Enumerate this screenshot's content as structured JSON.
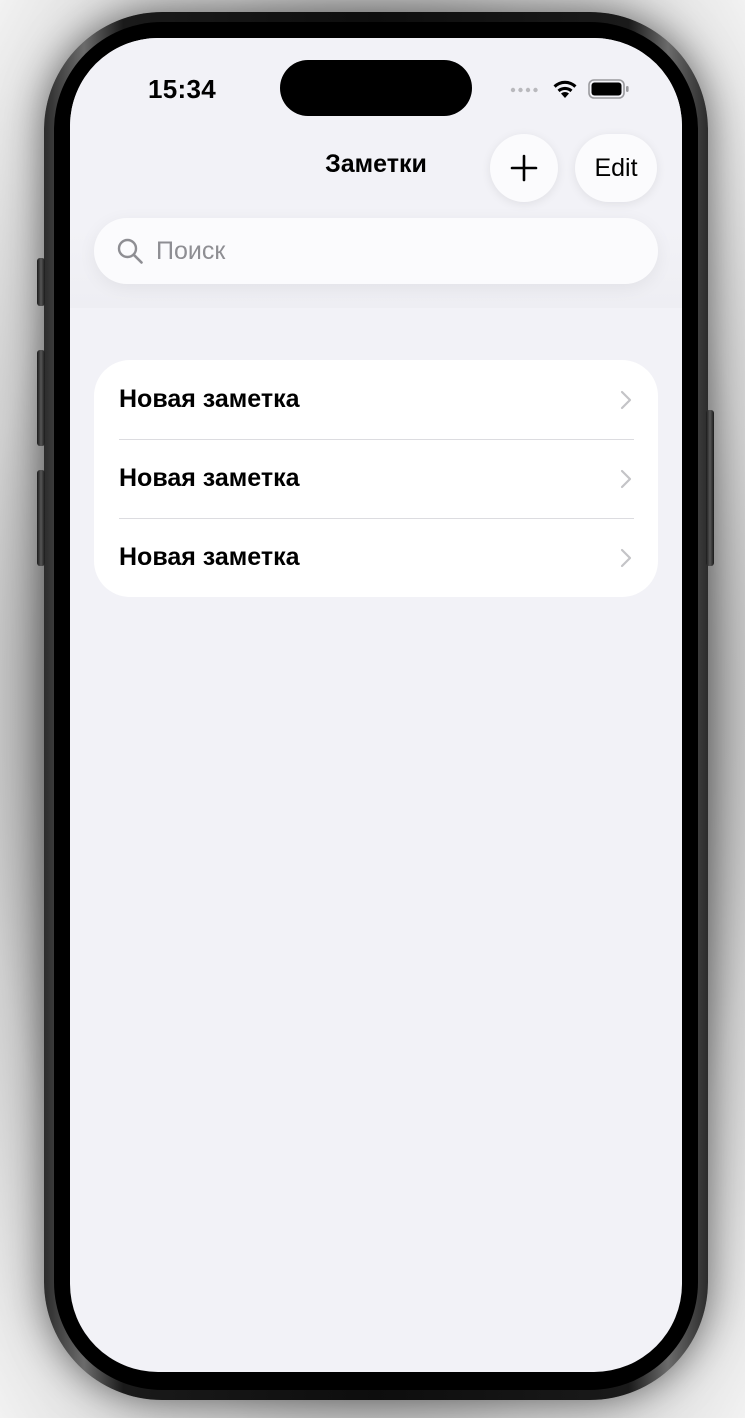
{
  "status_bar": {
    "time": "15:34",
    "icons": [
      "signal-dots-icon",
      "wifi-icon",
      "battery-icon"
    ]
  },
  "nav": {
    "title": "Заметки",
    "add_icon": "plus-icon",
    "edit_label": "Edit"
  },
  "search": {
    "placeholder": "Поиск",
    "value": "",
    "icon": "magnifying-glass-icon"
  },
  "notes": [
    {
      "title": "Новая заметка"
    },
    {
      "title": "Новая заметка"
    },
    {
      "title": "Новая заметка"
    }
  ],
  "colors": {
    "background": "#f2f2f7",
    "card": "#ffffff",
    "button_bg": "#fbfbfd",
    "placeholder": "#8e8e93",
    "separator": "#dcdce0",
    "chevron": "#c4c4c7"
  }
}
